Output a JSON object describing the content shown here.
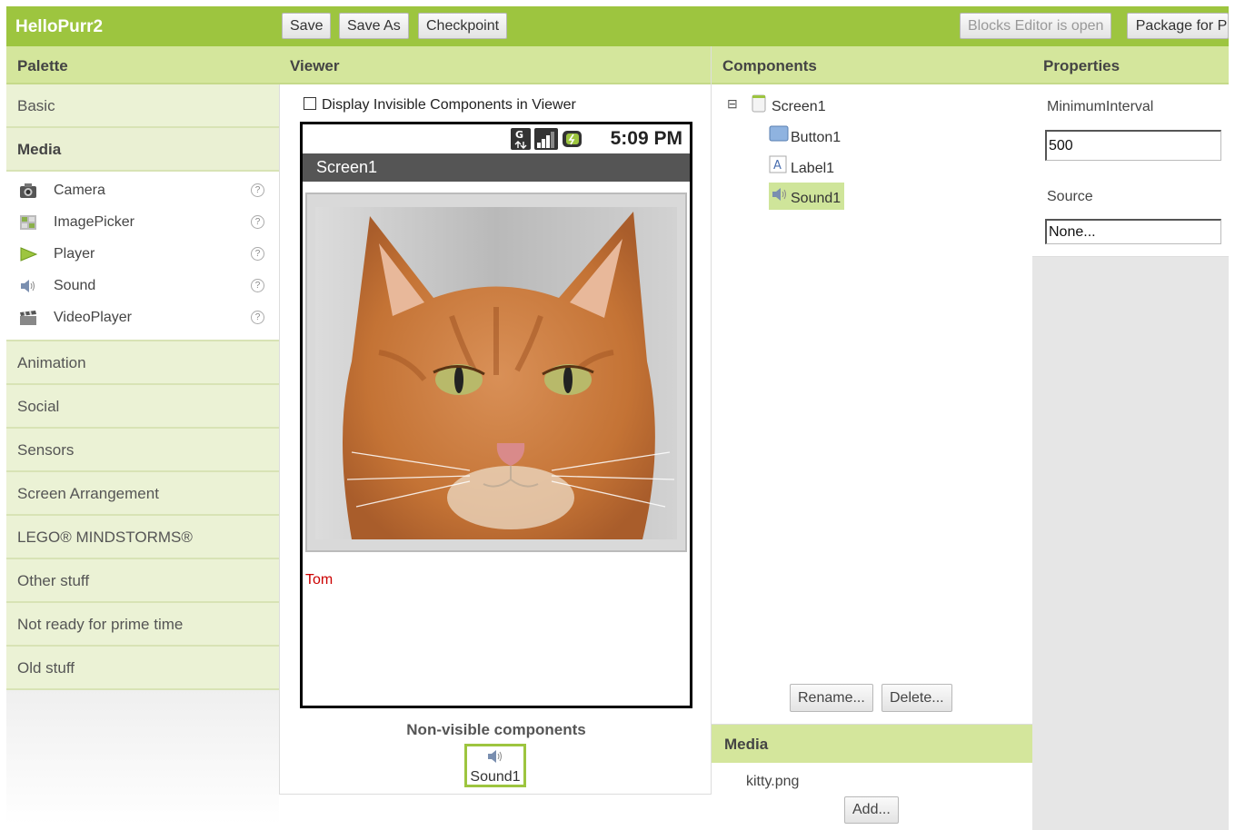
{
  "app": {
    "title": "HelloPurr2"
  },
  "toolbar": {
    "save": "Save",
    "save_as": "Save As",
    "checkpoint": "Checkpoint",
    "blocks_editor": "Blocks Editor is open",
    "package": "Package for P"
  },
  "palette": {
    "header": "Palette",
    "categories_before": [
      "Basic"
    ],
    "open_category": "Media",
    "items": [
      {
        "label": "Camera",
        "icon": "camera-icon"
      },
      {
        "label": "ImagePicker",
        "icon": "image-picker-icon"
      },
      {
        "label": "Player",
        "icon": "play-icon"
      },
      {
        "label": "Sound",
        "icon": "speaker-icon"
      },
      {
        "label": "VideoPlayer",
        "icon": "clapperboard-icon"
      }
    ],
    "categories_after": [
      "Animation",
      "Social",
      "Sensors",
      "Screen Arrangement",
      "LEGO® MINDSTORMS®",
      "Other stuff",
      "Not ready for prime time",
      "Old stuff"
    ]
  },
  "viewer": {
    "header": "Viewer",
    "display_invisible_label": "Display Invisible Components in Viewer",
    "display_invisible_checked": false,
    "status_time": "5:09 PM",
    "screen_title": "Screen1",
    "label_text": "Tom",
    "nonvisible_title": "Non-visible components",
    "nonvisible_items": [
      "Sound1"
    ]
  },
  "components": {
    "header": "Components",
    "tree": {
      "root": "Screen1",
      "children": [
        {
          "label": "Button1",
          "icon": "button-icon",
          "selected": false
        },
        {
          "label": "Label1",
          "icon": "label-icon",
          "selected": false
        },
        {
          "label": "Sound1",
          "icon": "speaker-icon",
          "selected": true
        }
      ]
    },
    "rename": "Rename...",
    "delete": "Delete..."
  },
  "media": {
    "header": "Media",
    "files": [
      "kitty.png"
    ],
    "add": "Add..."
  },
  "properties": {
    "header": "Properties",
    "items": [
      {
        "label": "MinimumInterval",
        "value": "500"
      },
      {
        "label": "Source",
        "value": "None..."
      }
    ]
  },
  "colors": {
    "accent": "#9dc53f",
    "header_bg": "#d4e69c",
    "label_text": "#cc0000"
  }
}
